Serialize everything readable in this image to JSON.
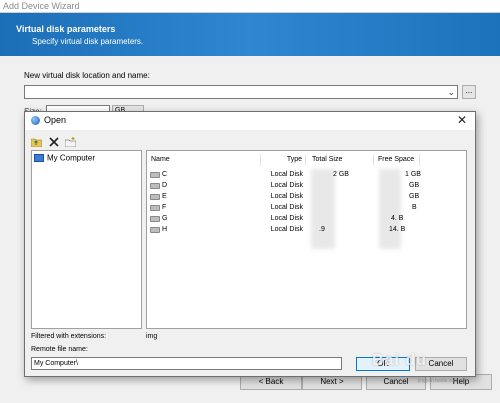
{
  "wizard": {
    "title": "Add Device Wizard",
    "header_title": "Virtual disk parameters",
    "header_subtitle": "Specify virtual disk parameters.",
    "location_label": "New virtual disk location and name:",
    "location_value": "",
    "browse_label": "...",
    "size_label": "Size:",
    "size_unit": "GB",
    "buttons": {
      "back": "< Back",
      "next": "Next >",
      "cancel": "Cancel",
      "help": "Help"
    }
  },
  "dialog": {
    "title": "Open",
    "close_glyph": "✕",
    "tree": {
      "root_label": "My Computer"
    },
    "columns": {
      "name": "Name",
      "type": "Type",
      "total": "Total Size",
      "free": "Free Space"
    },
    "rows": [
      {
        "name": "C",
        "type": "Local Disk",
        "total": "2 GB",
        "free": "1 GB"
      },
      {
        "name": "D",
        "type": "Local Disk",
        "total": "",
        "free": "GB"
      },
      {
        "name": "E",
        "type": "Local Disk",
        "total": "",
        "free": "GB"
      },
      {
        "name": "F",
        "type": "Local Disk",
        "total": "",
        "free": "B"
      },
      {
        "name": "G",
        "type": "Local Disk",
        "total": "",
        "free": "4. B"
      },
      {
        "name": "H",
        "type": "Local Disk",
        "total": ".9",
        "free": "14. B"
      }
    ],
    "filter_label": "Filtered with extensions:",
    "filter_value": "img",
    "remote_label": "Remote file name:",
    "remote_value": "My Computer\\",
    "ok_label": "OK",
    "cancel_label": "Cancel"
  },
  "watermark": {
    "text": "Bai du",
    "sub": "jingyan.baidu.com"
  },
  "colors": {
    "header_blue": "#2f86d1",
    "focus_blue": "#0078d7"
  }
}
